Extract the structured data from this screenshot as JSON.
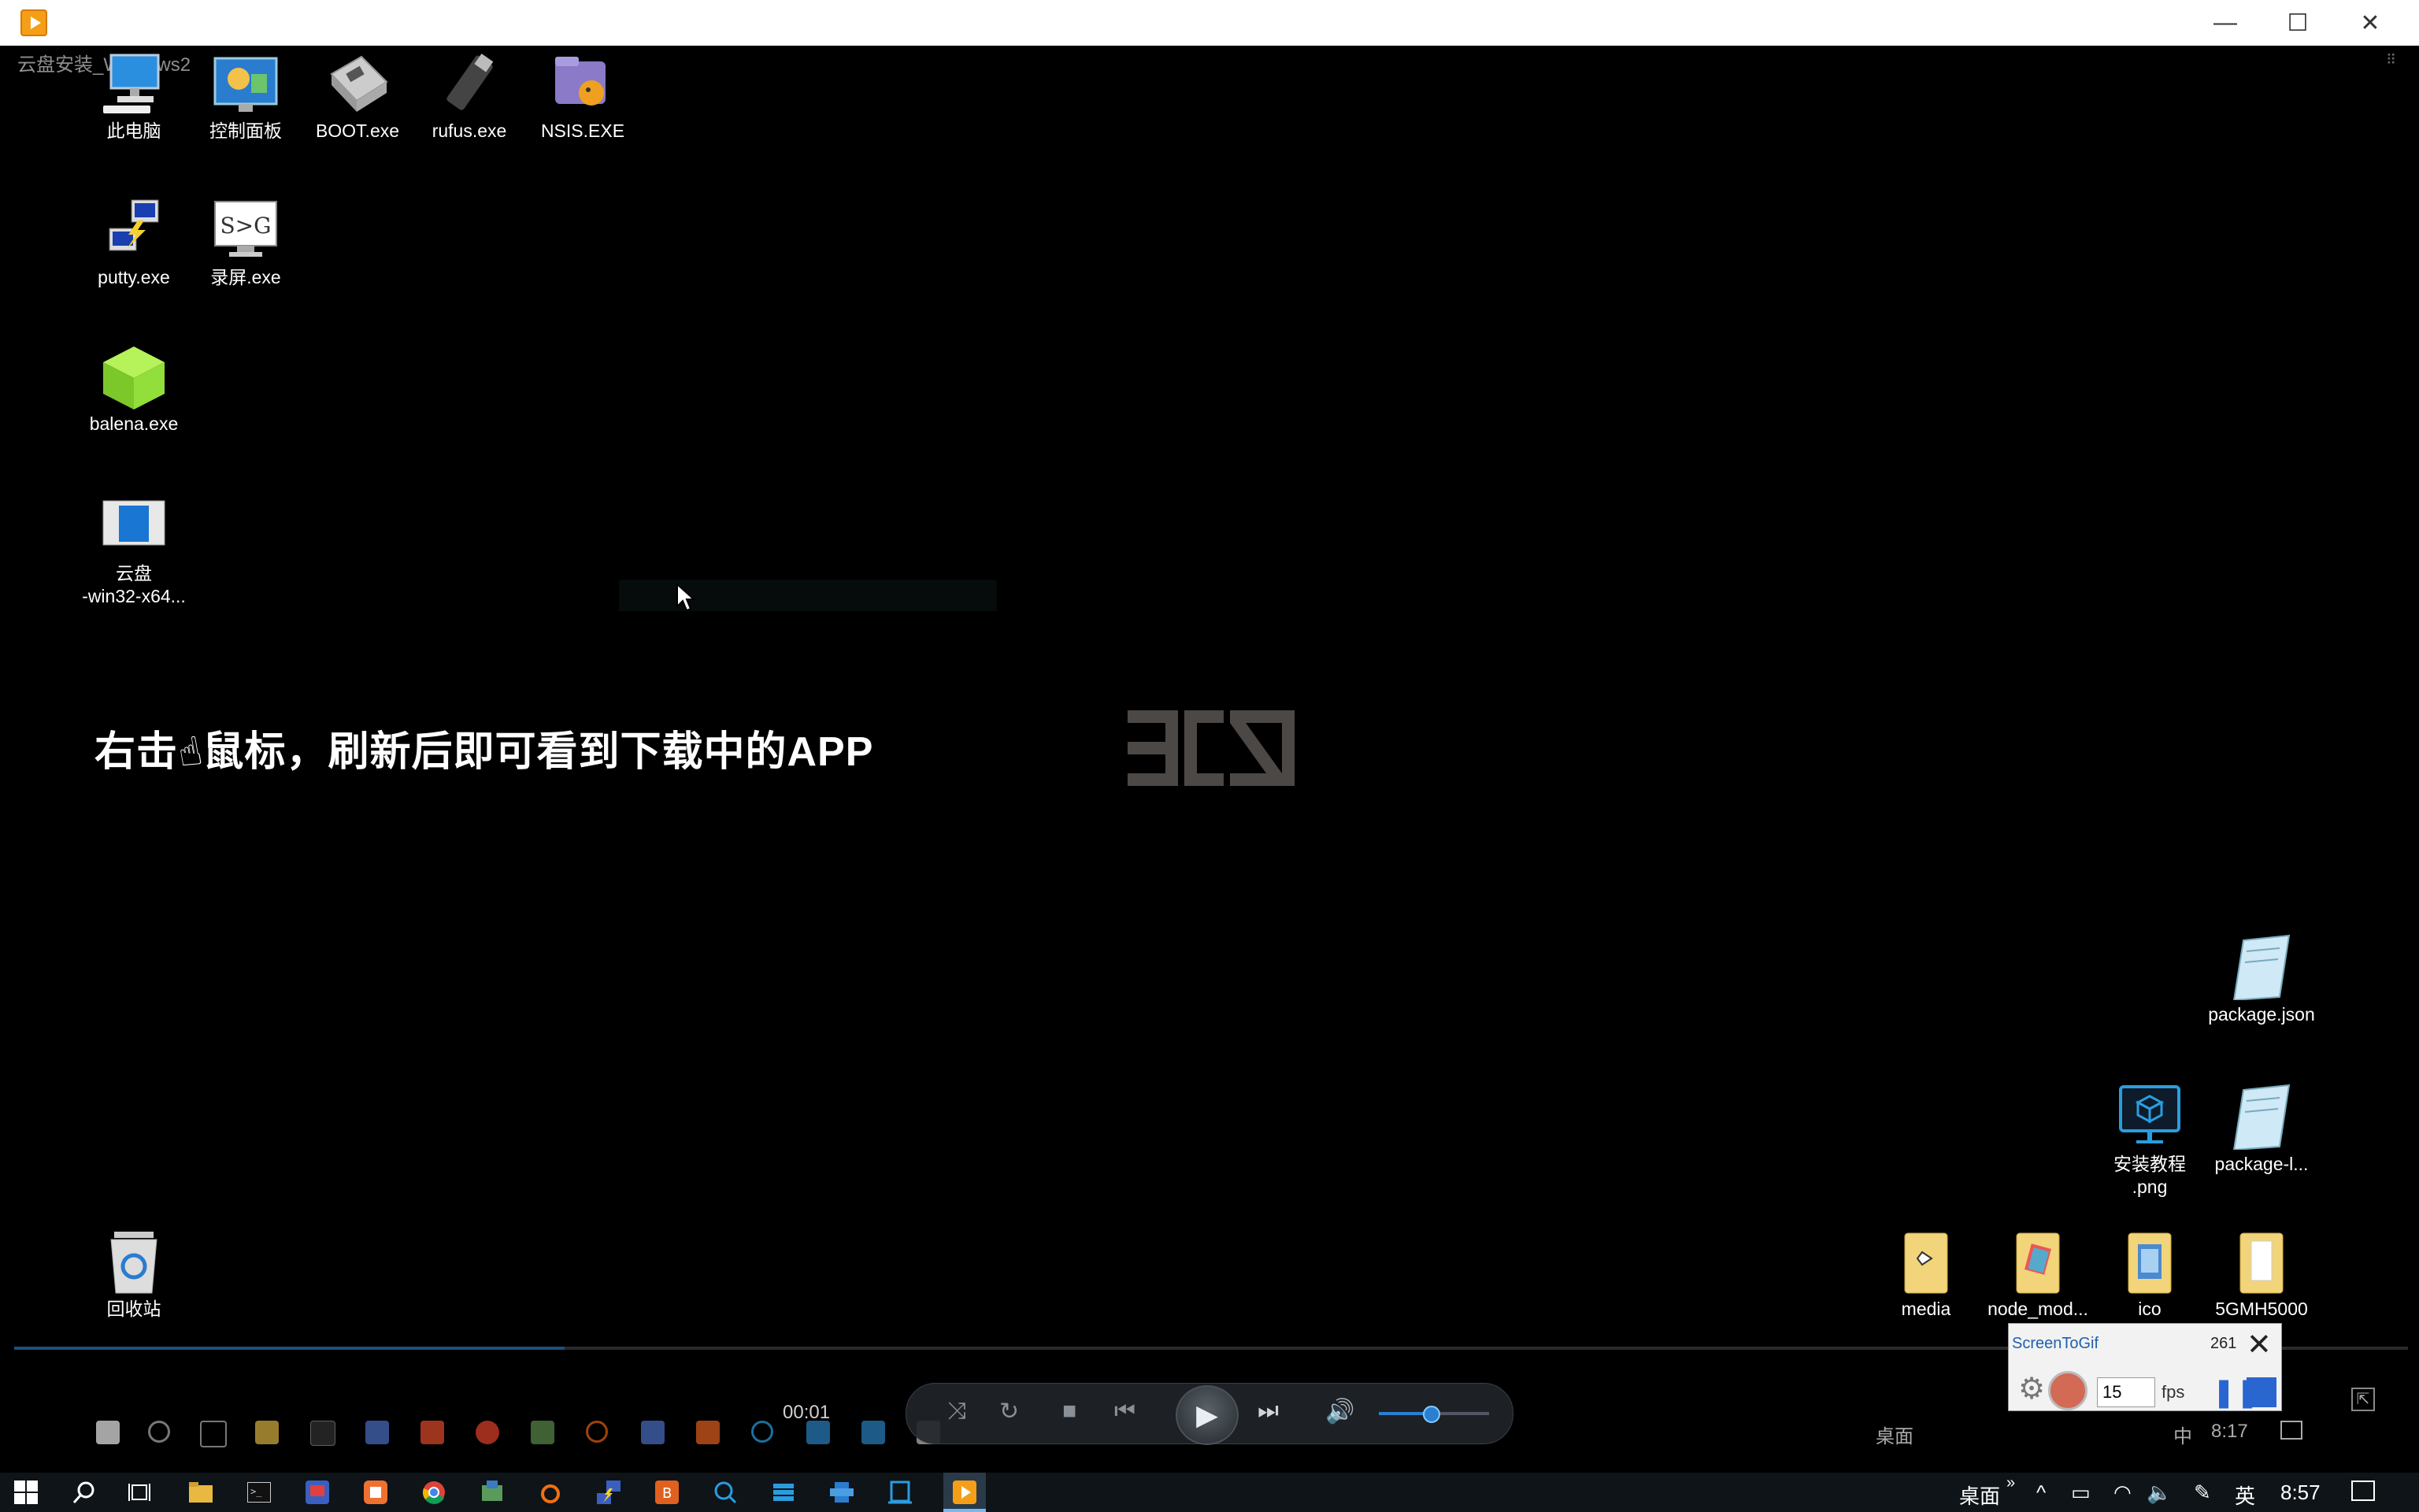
{
  "window": {
    "icon": "media-player-icon",
    "minimize": "—",
    "maximize": "☐",
    "close": "✕"
  },
  "video": {
    "title": "云盘安装_Windows2",
    "caption_before": "右击",
    "caption_after": "鼠标，刷新后即可看到下载中的APP",
    "time": "00:01",
    "progress_percent": 23
  },
  "desktop_icons": {
    "pc": "此电脑",
    "control": "控制面板",
    "boot": "BOOT.exe",
    "rufus": "rufus.exe",
    "nsis": "NSIS.EXE",
    "putty": "putty.exe",
    "s2g": "录屏.exe",
    "s2g_glyph": "S>G",
    "balena": "balena.exe",
    "yunpan_1": "云盘",
    "yunpan_2": "-win32-x64...",
    "recycle": "回收站",
    "package_json": "package.json",
    "tutorial_1": "安装教程",
    "tutorial_2": ".png",
    "package_l": "package-l...",
    "media": "media",
    "node_mod": "node_mod...",
    "ico": "ico",
    "gmh": "5GMH5000"
  },
  "inner_tray": {
    "desktop": "桌面",
    "ime": "中",
    "time": "8:17"
  },
  "screentogif": {
    "title": "ScreenToGif",
    "frames": "261",
    "fps_value": "15",
    "fps_label": "fps"
  },
  "taskbar": {
    "desktop": "桌面",
    "ime": "英",
    "time": "8:57"
  },
  "colors": {
    "accent": "#2a66d0",
    "titlebar": "#ffffff",
    "taskbar": "#0e1418"
  }
}
